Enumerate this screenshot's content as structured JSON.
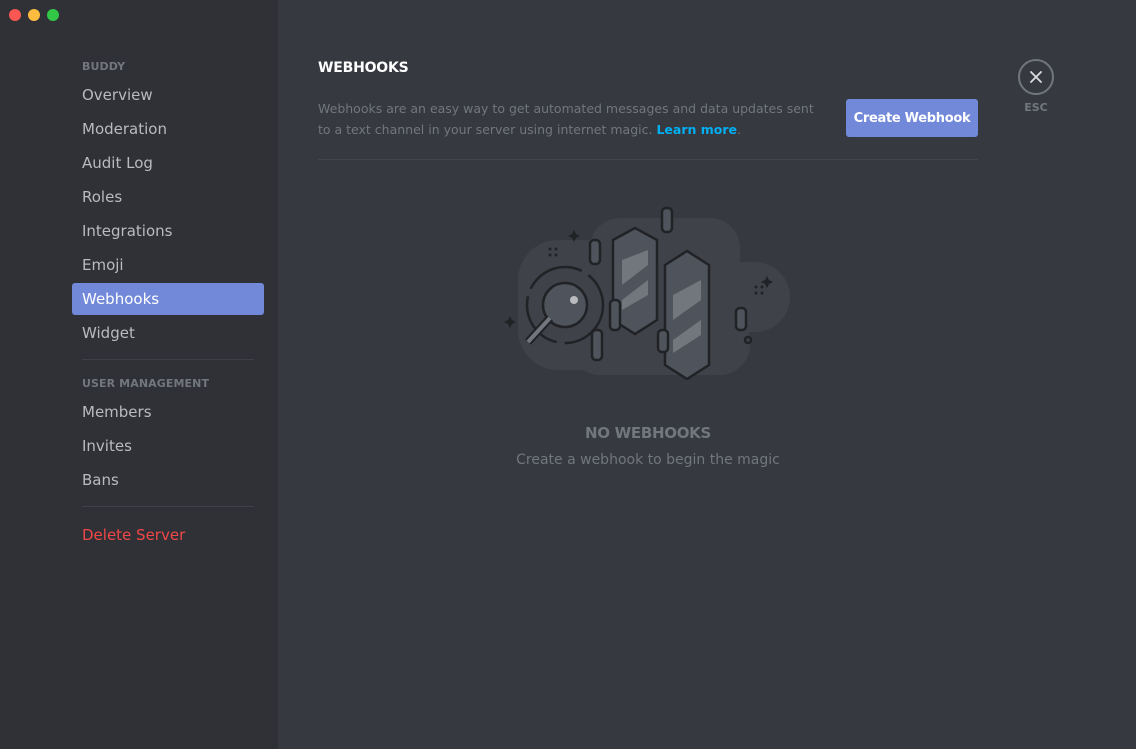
{
  "window": {
    "controls": [
      "close",
      "minimize",
      "maximize"
    ]
  },
  "sidebar": {
    "sections": [
      {
        "header": "BUDDY",
        "items": [
          {
            "label": "Overview"
          },
          {
            "label": "Moderation"
          },
          {
            "label": "Audit Log"
          },
          {
            "label": "Roles"
          },
          {
            "label": "Integrations"
          },
          {
            "label": "Emoji"
          },
          {
            "label": "Webhooks",
            "active": true
          },
          {
            "label": "Widget"
          }
        ]
      },
      {
        "header": "USER MANAGEMENT",
        "items": [
          {
            "label": "Members"
          },
          {
            "label": "Invites"
          },
          {
            "label": "Bans"
          }
        ]
      }
    ],
    "delete_server": "Delete Server"
  },
  "main": {
    "title": "WEBHOOKS",
    "description": "Webhooks are an easy way to get automated messages and data updates sent to a text channel in your server using internet magic.",
    "learn_more": "Learn more",
    "create_button": "Create Webhook",
    "close_label": "ESC",
    "empty_title": "NO WEBHOOKS",
    "empty_subtitle": "Create a webhook to begin the magic"
  },
  "colors": {
    "accent": "#7289da",
    "danger": "#f04747",
    "link": "#00b0f4",
    "sidebar_bg": "#2f3136",
    "main_bg": "#36393f"
  }
}
